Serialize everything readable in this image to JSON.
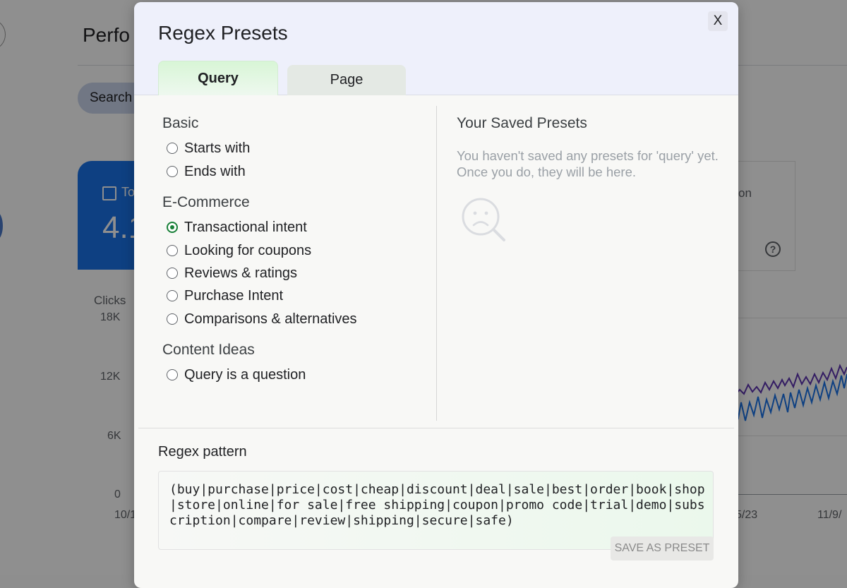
{
  "background": {
    "page_title": "Perfo",
    "search_label": "Search",
    "metric_label": "To",
    "metric_value": "4.1",
    "right_metric_label": "on",
    "help_icon": "help-circle-icon",
    "chart_ylabel": "Clicks",
    "y_ticks": [
      "18K",
      "12K",
      "6K",
      "0"
    ],
    "x_ticks": [
      "10/1",
      "5/23",
      "11/9/"
    ]
  },
  "modal": {
    "title": "Regex Presets",
    "close_label": "X",
    "tabs": [
      {
        "label": "Query",
        "active": true
      },
      {
        "label": "Page",
        "active": false
      }
    ],
    "sections": [
      {
        "title": "Basic",
        "options": [
          {
            "label": "Starts with",
            "checked": false
          },
          {
            "label": "Ends with",
            "checked": false
          }
        ]
      },
      {
        "title": "E-Commerce",
        "options": [
          {
            "label": "Transactional intent",
            "checked": true
          },
          {
            "label": "Looking for coupons",
            "checked": false
          },
          {
            "label": "Reviews & ratings",
            "checked": false
          },
          {
            "label": "Purchase Intent",
            "checked": false
          },
          {
            "label": "Comparisons & alternatives",
            "checked": false
          }
        ]
      },
      {
        "title": "Content Ideas",
        "options": [
          {
            "label": "Query is a question",
            "checked": false
          }
        ]
      }
    ],
    "saved": {
      "title": "Your Saved Presets",
      "empty_message": "You haven't saved any presets for 'query' yet. Once you do, they will be here.",
      "empty_icon": "sad-search-icon"
    },
    "regex": {
      "label": "Regex pattern",
      "value": "(buy|purchase|price|cost|cheap|discount|deal|sale|best|order|book|shop|store|online|for sale|free shipping|coupon|promo code|trial|demo|subscription|compare|review|shipping|secure|safe)",
      "save_label": "SAVE AS PRESET"
    }
  },
  "colors": {
    "accent_green": "#188038",
    "header_bg": "#eef0fb",
    "brand_blue": "#1a73e8"
  }
}
